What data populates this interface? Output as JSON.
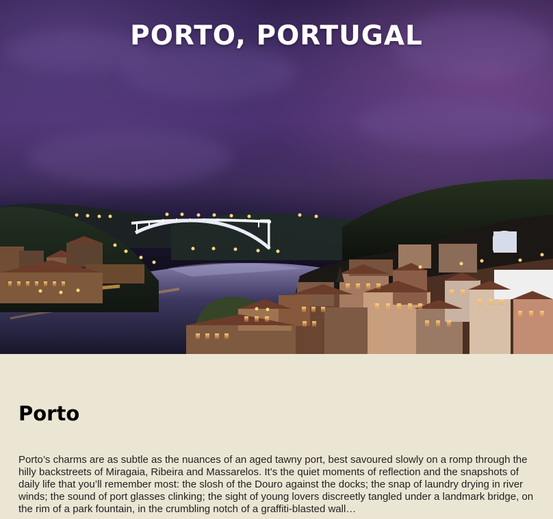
{
  "hero": {
    "title": "PORTO, PORTUGAL",
    "image": "porto-night-cityscape"
  },
  "content": {
    "heading": "Porto",
    "paragraph": "Porto’s charms are as subtle as the nuances of an aged tawny port, best savoured slowly on a romp through the hilly backstreets of Miragaia, Ribeira and Massarelos. It’s the quiet moments of reflection and the snapshots of daily life that you’ll remember most: the slosh of the Douro against the docks; the snap of laundry drying in river winds; the sound of port glasses clinking; the sight of young lovers discreetly tangled under a landmark bridge, on the rim of a park fountain, in the crumbling notch of a graffiti-blasted wall…"
  }
}
